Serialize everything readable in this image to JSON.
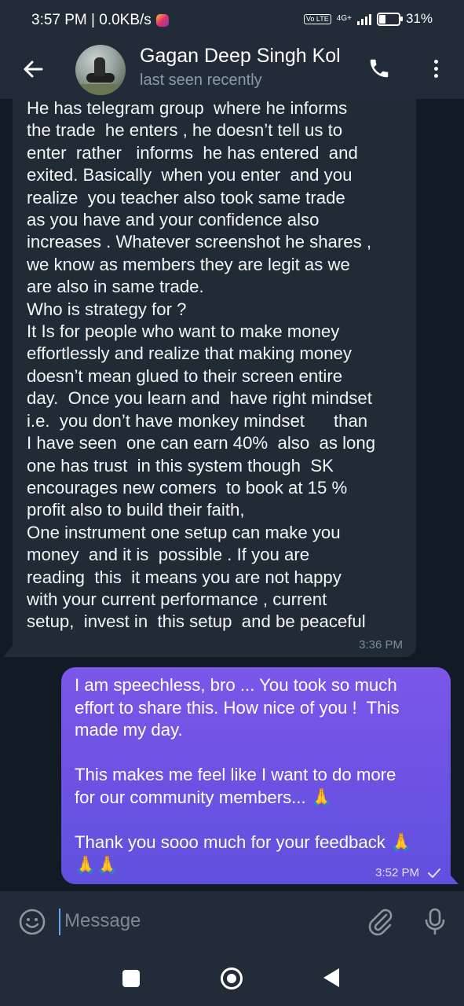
{
  "status_bar": {
    "time_speed": "3:57 PM | 0.0KB/s",
    "volte": "Vo LTE",
    "network": "4G+",
    "battery": "31%",
    "battery_level": 0.31
  },
  "header": {
    "contact_name": "Gagan Deep Singh Kol",
    "contact_status": "last seen recently",
    "icons": [
      "back-arrow-icon",
      "avatar",
      "phone-icon",
      "more-vert-icon"
    ]
  },
  "messages": [
    {
      "direction": "incoming",
      "text": "He has telegram group  where he informs\nthe trade  he enters , he doesn’t tell us to\nenter  rather   informs  he has entered  and\nexited. Basically  when you enter  and you\nrealize  you teacher also took same trade\nas you have and your confidence also\nincreases . Whatever screenshot he shares ,\nwe know as members they are legit as we\nare also in same trade.\nWho is strategy for ?\nIt Is for people who want to make money\neffortlessly and realize that making money\ndoesn’t mean glued to their screen entire\nday.  Once you learn and  have right mindset\ni.e.  you don’t have monkey mindset      than\nI have seen  one can earn 40%  also  as long\none has trust  in this system though  SK\nencourages new comers  to book at 15 %\nprofit also to build their faith,\nOne instrument one setup can make you\nmoney  and it is  possible . If you are\nreading  this  it means you are not happy\nwith your current performance , current\nsetup,  invest in  this setup  and be peaceful",
      "time": "3:36 PM"
    },
    {
      "direction": "outgoing",
      "text": "I am speechless, bro ... You took so much\neffort to share this. How nice of you !  This\nmade my day.\n\nThis makes me feel like I want to do more\nfor our community members... 🙏\n\nThank you sooo much for your feedback 🙏\n🙏🙏",
      "time": "3:52 PM",
      "status_icon": "check-icon"
    }
  ],
  "input": {
    "placeholder": "Message",
    "value": ""
  },
  "nav": [
    "recents-square-icon",
    "home-circle-icon",
    "back-triangle-icon"
  ]
}
